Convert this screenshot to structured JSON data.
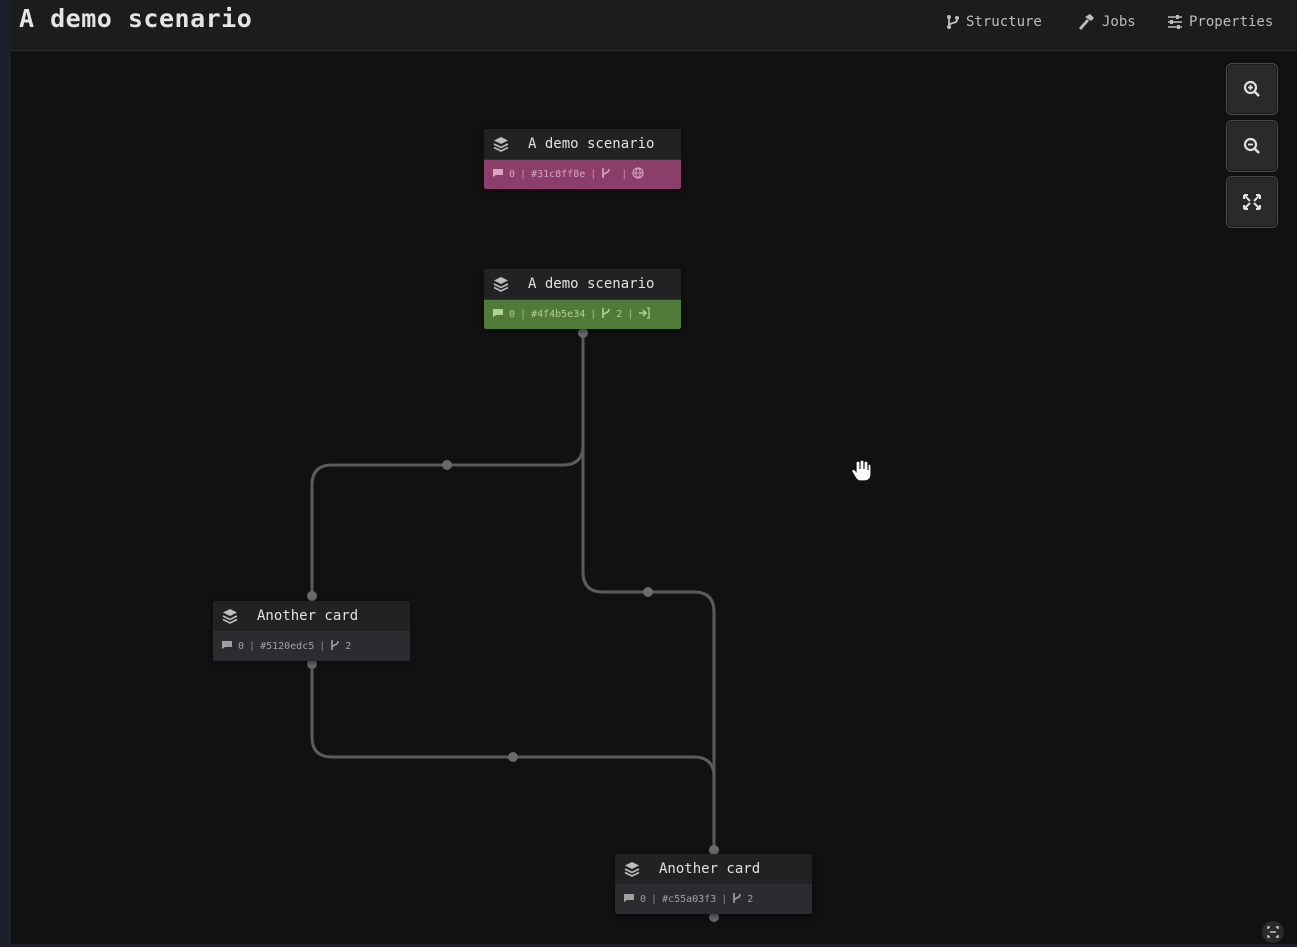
{
  "header": {
    "title": "A demo scenario",
    "nav": {
      "structure": "Structure",
      "jobs": "Jobs",
      "properties": "Properties"
    }
  },
  "cards": [
    {
      "title": "A demo scenario",
      "comments": "0",
      "hash": "#31c8ff8e",
      "branches": "",
      "extra": "globe-icon",
      "color": "#8a3e69"
    },
    {
      "title": "A demo scenario",
      "comments": "0",
      "hash": "#4f4b5e34",
      "branches": "2",
      "extra": "sign-in-icon",
      "color": "#4f7a37"
    },
    {
      "title": "Another card",
      "comments": "0",
      "hash": "#5120edc5",
      "branches": "2",
      "extra": "",
      "color": "#2a2c2f"
    },
    {
      "title": "Another card",
      "comments": "0",
      "hash": "#c55a03f3",
      "branches": "2",
      "extra": "",
      "color": "#2a2c2f"
    }
  ],
  "controls": {
    "zoom_in": "zoom-in-icon",
    "zoom_out": "zoom-out-icon",
    "fit": "fit-view-icon"
  }
}
